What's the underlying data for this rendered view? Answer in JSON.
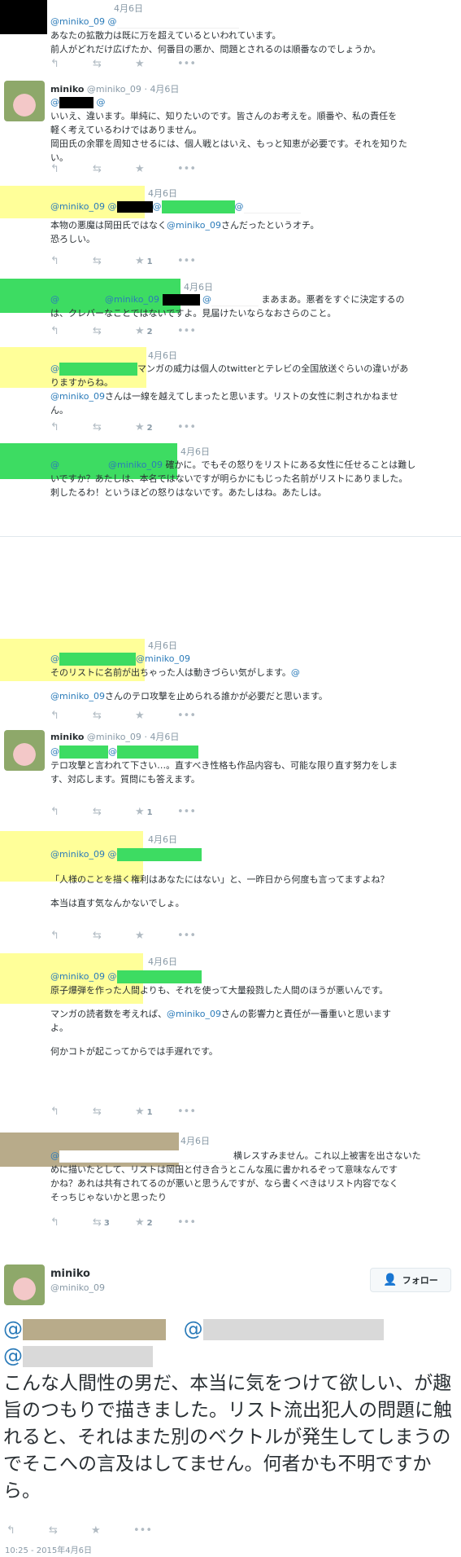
{
  "tweets": [
    {
      "date": "4月6日",
      "lines": [
        "あなたの拡散力は既に万を超えているといわれています。",
        "前人がどれだけ広げたか、何番目の悪か、問題とされるのは順番なのでしょうか。"
      ],
      "mention": "@miniko_09 @"
    },
    {
      "name": "miniko",
      "handle": "@miniko_09",
      "date": "4月6日",
      "mention": "@",
      "lines": [
        "いいえ、違います。単純に、知りたいのです。皆さんのお考えを。順番や、私の責任を",
        "軽く考えているわけではありません。",
        "岡田氏の余罪を周知させるには、個人戦とはいえ、もっと知恵が必要です。それを知りた",
        "い。"
      ]
    },
    {
      "date": "4月6日",
      "mention": "@miniko_09 @",
      "mention2": "@",
      "mention3": "@",
      "lines": [
        "本物の悪魔は岡田氏ではなく",
        "さんだったというオチ。",
        "恐ろしい。"
      ],
      "inline_mention": "@miniko_09",
      "fav": "1"
    },
    {
      "date": "4月6日",
      "mention": "@",
      "mention2": "@miniko_09",
      "mention3": "@",
      "tail": "まあまあ。悪者をすぐに決定するの",
      "lines": [
        "は、クレバーなことではないですよ。見届けたいならなおさらのこと。"
      ],
      "fav": "2"
    },
    {
      "date": "4月6日",
      "mention": "@",
      "lines": [
        "マンガの威力は個人のtwitterとテレビの全国放送ぐらいの違いがあ",
        "りますからね。",
        "さんは一線を越えてしまったと思います。リストの女性に刺されかねませ",
        "ん。"
      ],
      "inline_mention": "@miniko_09",
      "fav": "2"
    },
    {
      "date": "4月6日",
      "mention": "@",
      "mention2": "@miniko_09",
      "tail": "確かに。でもその怒りをリストにある女性に任せることは難し",
      "lines": [
        "いですか？あたしは、本名ではないですが明らかにもじった名前がリストにありました。",
        "刺したるわ！というほどの怒りはないです。あたしはね。あたしは。"
      ]
    },
    {
      "date": "4月6日",
      "mention": "@",
      "mention2": "@miniko_09",
      "lines": [
        "そのリストに名前が出ちゃった人は動きづらい気がします。",
        "さんのテロ攻撃を止められる誰かが必要だと思います。"
      ],
      "trail_mention": "@",
      "inline_mention": "@miniko_09"
    },
    {
      "name": "miniko",
      "handle": "@miniko_09",
      "date": "4月6日",
      "mention": "@",
      "mention2": "@",
      "lines": [
        "テロ攻撃と言われて下さい…。直すべき性格も作品内容も、可能な限り直す努力をしま",
        "す、対応します。質問にも答えます。"
      ],
      "fav": "1"
    },
    {
      "date": "4月6日",
      "mention": "@miniko_09 @",
      "lines": [
        "「人様のことを描く権利はあなたにはない」と、一昨日から何度も言ってますよね？",
        "本当は直す気なんかないでしょ。"
      ]
    },
    {
      "date": "4月6日",
      "mention": "@miniko_09 @",
      "lines": [
        "原子爆弾を作った人間よりも、それを使って大量殺戮した人間のほうが悪いんです。",
        "マンガの読者数を考えれば、",
        "さんの影響力と責任が一番重いと思います",
        "よ。",
        "何かコトが起こってからでは手遅れです。"
      ],
      "inline_mention": "@miniko_09",
      "fav": "1"
    },
    {
      "date": "4月6日",
      "mention": "@",
      "tail": "横レスすみません。これ以上被害を出さないた",
      "lines": [
        "めに描いたとして、リストは岡田と付き合うとこんな風に書かれるぞって意味なんです",
        "かね？あれは共有されてるのが悪いと思うんですが、なら書くべきはリスト内容でなく",
        "そっちじゃないかと思ったり"
      ],
      "retweets": "3",
      "fav": "2"
    }
  ],
  "main_tweet": {
    "name": "miniko",
    "handle": "@miniko_09",
    "follow_label": "フォロー",
    "mention_a": "@",
    "mention_b": "@",
    "mention_c": "@",
    "text": "こんな人間性の男だ、本当に気をつけて欲しい、が趣旨のつもりで描きました。リスト流出犯人の問題に触れると、それはまた別のベクトルが発生してしまうのでそこへの言及はしてません。何者かも不明ですから。",
    "timestamp": "10:25 - 2015年4月6日"
  },
  "icons": {
    "reply": "reply-icon",
    "retweet": "retweet-icon",
    "favorite": "star-icon",
    "more": "more-icon",
    "follow": "person-plus-icon"
  }
}
